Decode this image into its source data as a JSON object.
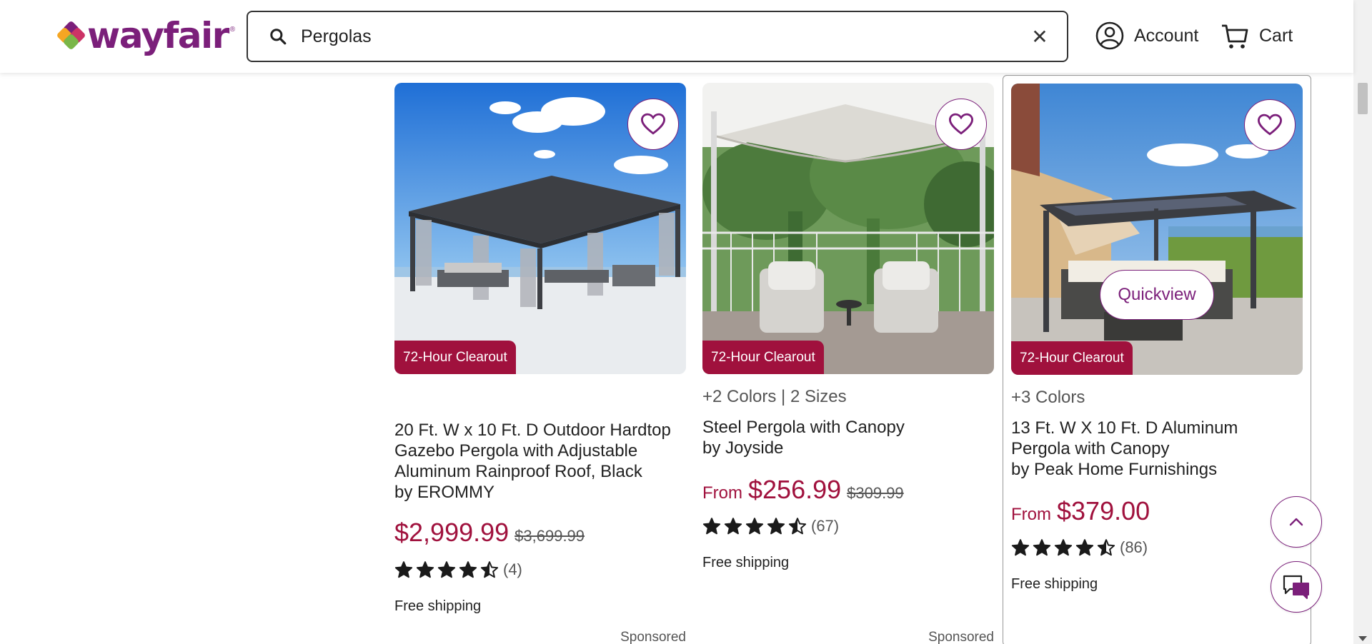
{
  "brand": {
    "name": "wayfair",
    "colors": {
      "purple": "#7b1f7a",
      "sale_red": "#a0113d"
    }
  },
  "header": {
    "search": {
      "value": "Pergolas",
      "placeholder": "Find anything home..."
    },
    "account_label": "Account",
    "cart_label": "Cart"
  },
  "products": [
    {
      "badge": "72-Hour Clearout",
      "options": "",
      "title": "20 Ft. W x 10 Ft. D Outdoor Hardtop Gazebo Pergola with Adjustable Aluminum Rainproof Roof, Black",
      "brand": "by EROMMY",
      "from": "",
      "price": "$2,999.99",
      "was": "$3,699.99",
      "rating": 4.5,
      "review_count": "(4)",
      "shipping": "Free shipping",
      "sponsored": "Sponsored"
    },
    {
      "badge": "72-Hour Clearout",
      "options": "+2 Colors | 2 Sizes",
      "title": "Steel Pergola with Canopy",
      "brand": "by Joyside",
      "from": "From",
      "price": "$256.99",
      "was": "$309.99",
      "rating": 4.5,
      "review_count": "(67)",
      "shipping": "Free shipping",
      "sponsored": "Sponsored"
    },
    {
      "badge": "72-Hour Clearout",
      "options": "+3 Colors",
      "title": "13 Ft. W X 10 Ft. D Aluminum Pergola with Canopy",
      "brand": "by Peak Home Furnishings",
      "from": "From",
      "price": "$379.00",
      "was": "",
      "rating": 4.5,
      "review_count": "(86)",
      "shipping": "Free shipping",
      "quickview": "Quickview"
    }
  ],
  "icons": {
    "search": "search-icon",
    "clear": "close-icon",
    "account": "user-circle-icon",
    "cart": "cart-icon",
    "favorite": "heart-icon",
    "star": "star-icon",
    "back_to_top": "chevron-up-icon",
    "chat": "chat-icon"
  }
}
